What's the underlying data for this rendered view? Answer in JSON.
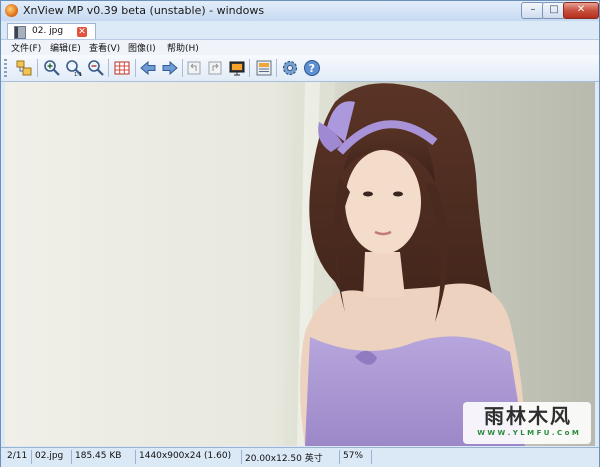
{
  "window": {
    "title": "XnView MP v0.39 beta (unstable) - windows",
    "min_label": "–",
    "max_label": "□",
    "close_label": "✕"
  },
  "tab": {
    "label": "02. jpg",
    "close_label": "✕"
  },
  "menu": {
    "items": [
      "文件(F)",
      "编辑(E)",
      "查看(V)",
      "图像(I)",
      "帮助(H)"
    ]
  },
  "toolbar": {
    "icons": [
      "browser-icon",
      "zoom-in-icon",
      "zoom-actual-icon",
      "zoom-out-icon",
      "grid-icon",
      "arrow-left-icon",
      "arrow-right-icon",
      "rotate-left-icon",
      "rotate-right-icon",
      "slideshow-icon",
      "info-icon",
      "settings-icon",
      "help-icon"
    ]
  },
  "viewport": {
    "watermark_main": "雨林木风",
    "watermark_url": "W W W . Y L M F U . C o M"
  },
  "status": {
    "index": "2/11",
    "filename": "02.jpg",
    "filesize": "185.45 KB",
    "dimensions": "1440x900x24 (1.60)",
    "print_size": "20.00x12.50 英寸",
    "zoom": "57%"
  }
}
